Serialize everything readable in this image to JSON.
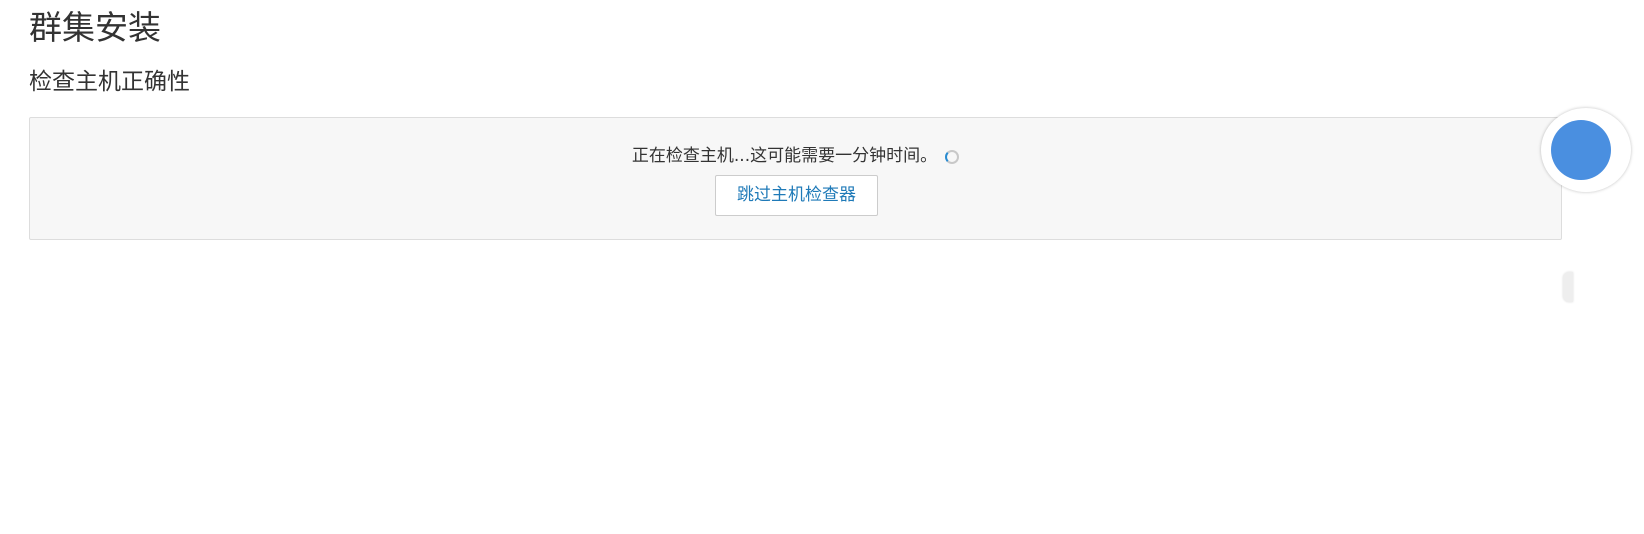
{
  "header": {
    "page_title": "群集安装",
    "section_title": "检查主机正确性"
  },
  "host_check": {
    "status_text": "正在检查主机...这可能需要一分钟时间。",
    "spinner_icon": "loading-spinner-icon",
    "skip_button_label": "跳过主机检查器"
  },
  "colors": {
    "panel_background": "#f7f7f7",
    "panel_border": "#dddddd",
    "link_blue": "#1f7ab8",
    "spinner_accent": "#2a8bd0",
    "widget_blue": "#4a8fe0"
  },
  "overlays": {
    "floating_widget_icon": "floating-assistant-icon",
    "edge_tab_icon": "side-tab-handle"
  }
}
